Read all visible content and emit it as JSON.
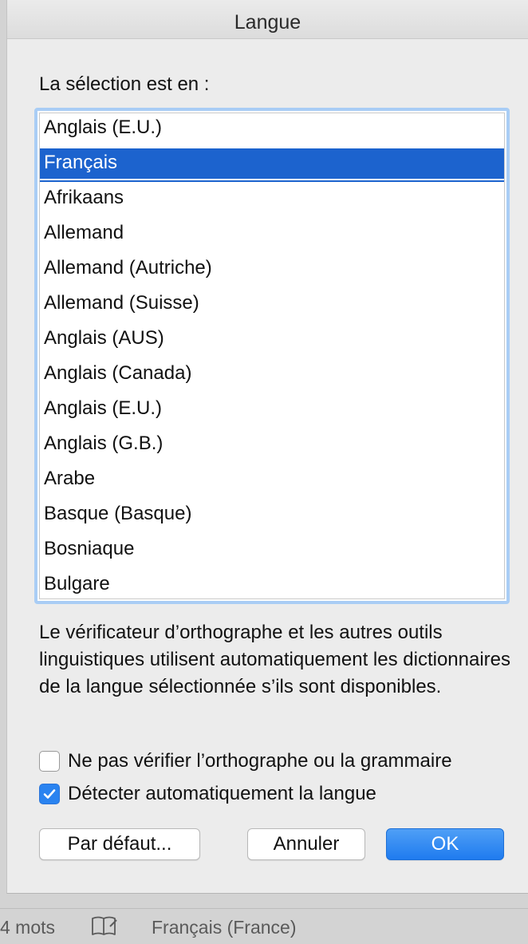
{
  "dialog": {
    "title": "Langue",
    "selection_label": "La sélection est en :",
    "languages": [
      "Anglais (E.U.)",
      "Français",
      "Afrikaans",
      "Allemand",
      "Allemand (Autriche)",
      "Allemand (Suisse)",
      "Anglais (AUS)",
      "Anglais (Canada)",
      "Anglais (E.U.)",
      "Anglais (G.B.)",
      "Arabe",
      "Basque (Basque)",
      "Bosniaque",
      "Bulgare"
    ],
    "selected_language": "Français",
    "info_text": "Le vérificateur d’orthographe et les autres outils linguistiques utilisent automatiquement les dictionnaires de la langue sélectionnée s’ils sont disponibles.",
    "checkbox_no_check": {
      "label": "Ne pas vérifier l’orthographe ou la grammaire",
      "checked": false
    },
    "checkbox_detect": {
      "label": "Détecter automatiquement la langue",
      "checked": true
    },
    "buttons": {
      "default": "Par défaut...",
      "cancel": "Annuler",
      "ok": "OK"
    }
  },
  "statusbar": {
    "word_count": "4 mots",
    "language": "Français (France)"
  },
  "colors": {
    "selection": "#1c63ce",
    "accent": "#2a83f0"
  }
}
